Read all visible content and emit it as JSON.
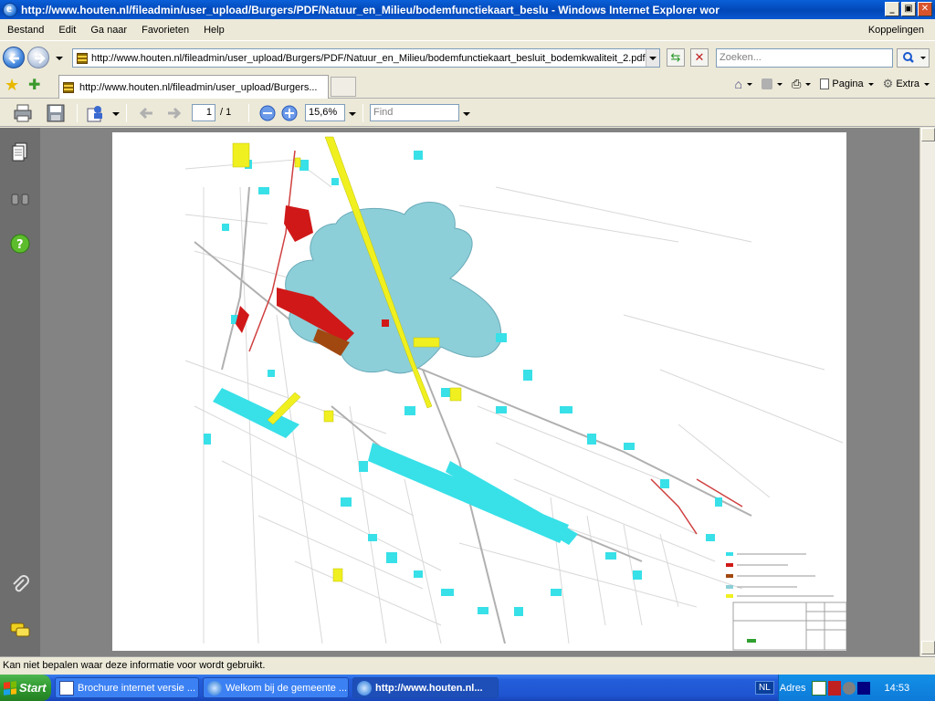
{
  "window": {
    "title": "http://www.houten.nl/fileadmin/user_upload/Burgers/PDF/Natuur_en_Milieu/bodemfunctiekaart_beslu - Windows Internet Explorer wor"
  },
  "menu": {
    "items": [
      "Bestand",
      "Edit",
      "Ga naar",
      "Favorieten",
      "Help"
    ],
    "links_label": "Koppelingen"
  },
  "address": {
    "url": "http://www.houten.nl/fileadmin/user_upload/Burgers/PDF/Natuur_en_Milieu/bodemfunctiekaart_besluit_bodemkwaliteit_2.pdf",
    "search_placeholder": "Zoeken..."
  },
  "tabs": {
    "active_title": "http://www.houten.nl/fileadmin/user_upload/Burgers...",
    "cmd_page": "Pagina",
    "cmd_extra": "Extra"
  },
  "pdf_toolbar": {
    "page_current": "1",
    "page_total": "/ 1",
    "zoom": "15,6%",
    "find_placeholder": "Find"
  },
  "status": {
    "text": "Kan niet bepalen waar deze informatie voor wordt gebruikt."
  },
  "taskbar": {
    "start_label": "Start",
    "buttons": [
      "Brochure internet versie ...",
      "Welkom bij de gemeente ...",
      "http://www.houten.nl..."
    ],
    "tray_adres": "Adres",
    "tray_lang": "NL",
    "clock": "14:53"
  },
  "colors": {
    "map_cyan": "#38e0e8",
    "map_red": "#d01818",
    "map_yellow": "#f0f020",
    "map_brown": "#a04810",
    "map_gray_blob": "#8ccfd8"
  }
}
